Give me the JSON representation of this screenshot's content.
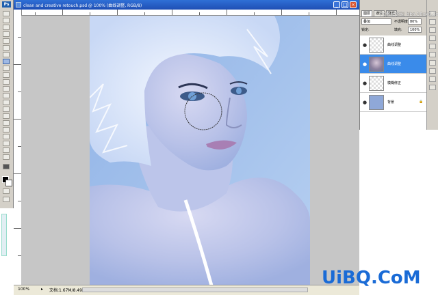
{
  "app": {
    "logo": "Ps"
  },
  "document": {
    "title": "clean and creative retouch.psd @ 100% (曲线调整, RGB/8)",
    "zoom": "100%",
    "doc_size": "文档:1.67M/8.49M",
    "window_buttons": [
      "_",
      "□",
      "×"
    ]
  },
  "layers_panel": {
    "tabs": [
      "图层",
      "通道",
      "路径"
    ],
    "blend_mode": "叠加",
    "opacity_label": "不透明度:",
    "opacity": "80%",
    "lock_label": "锁定:",
    "fill_label": "填充:",
    "fill": "100%",
    "layers": [
      {
        "name": "曲线调整",
        "selected": false,
        "thumb": "transparent"
      },
      {
        "name": "曲线调整",
        "selected": true,
        "thumb": "face"
      },
      {
        "name": "模糊修正",
        "selected": false,
        "thumb": "transparent"
      },
      {
        "name": "背景",
        "selected": false,
        "thumb": "img",
        "locked": true
      }
    ]
  },
  "watermarks": {
    "top": "PS教程论坛 bbs.16xx8.com",
    "bottom": "UiBQ.CoM"
  },
  "colors": {
    "accent": "#3a8bea",
    "title_bar": "#2f6fd6",
    "watermark_blue": "#1a6bd6"
  }
}
